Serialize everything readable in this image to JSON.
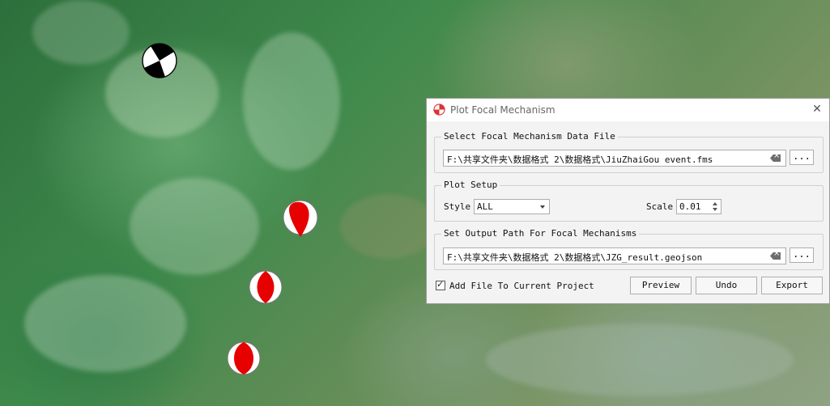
{
  "dialog": {
    "title": "Plot Focal Mechanism",
    "icon": "focal-mechanism-icon",
    "close_icon": "close-icon",
    "data_file_group": {
      "legend": "Select Focal Mechanism Data File",
      "path": "F:\\共享文件夹\\数据格式 2\\数据格式\\JiuZhaiGou event.fms",
      "browse_label": "..."
    },
    "plot_setup_group": {
      "legend": "Plot Setup",
      "style_label": "Style",
      "style_value": "ALL",
      "scale_label": "Scale",
      "scale_value": "0.01"
    },
    "output_group": {
      "legend": "Set Output Path For Focal Mechanisms",
      "path": "F:\\共享文件夹\\数据格式 2\\数据格式\\JZG_result.geojson",
      "browse_label": "..."
    },
    "add_to_project": {
      "label": "Add File To Current Project",
      "checked": true
    },
    "buttons": {
      "preview": "Preview",
      "undo": "Undo",
      "export": "Export"
    }
  },
  "map": {
    "beachball_colors": {
      "compressional_black": "#000000",
      "compressional_red": "#e60000",
      "dilatational": "#ffffff"
    }
  }
}
